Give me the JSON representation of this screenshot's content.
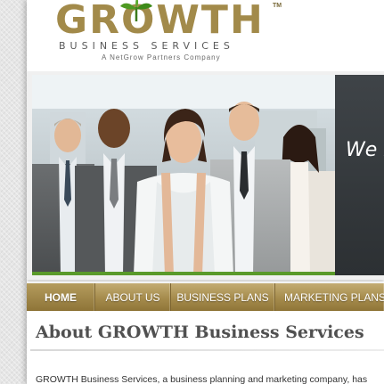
{
  "brand": {
    "name": "GROWTH",
    "trademark": "TM",
    "subtitle": "BUSINESS SERVICES",
    "tagline": "A NetGrow Partners Company"
  },
  "hero": {
    "panel_text": "We F"
  },
  "nav": {
    "items": [
      {
        "label": "HOME",
        "active": true
      },
      {
        "label": "ABOUT US",
        "active": false
      },
      {
        "label": "BUSINESS PLANS",
        "active": false
      },
      {
        "label": "MARKETING PLANS",
        "active": false
      }
    ]
  },
  "main": {
    "heading": "About GROWTH Business Services",
    "intro": "GROWTH Business Services, a business planning and marketing company, has"
  },
  "colors": {
    "brand_gold": "#a28a4a",
    "nav_gold": "#a58b4c",
    "hero_panel": "#3f4448",
    "accent_green": "#5a9a2a"
  }
}
